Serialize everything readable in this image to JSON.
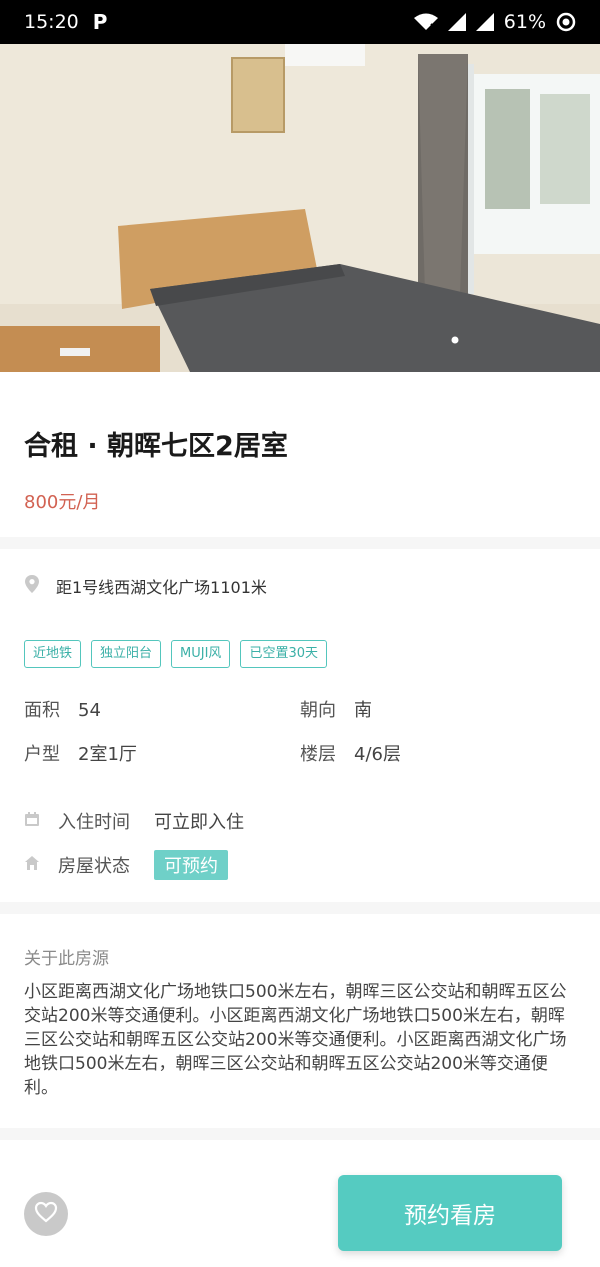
{
  "status_bar": {
    "time": "15:20",
    "app_icon": "P",
    "battery": "61%"
  },
  "listing": {
    "title": "合租 · 朝晖七区2居室",
    "price": "800元/月",
    "location": "距1号线西湖文化广场1101米",
    "tags": [
      "近地铁",
      "独立阳台",
      "MUJI风",
      "已空置30天"
    ],
    "specs": {
      "area_label": "面积",
      "area_value": "54",
      "orientation_label": "朝向",
      "orientation_value": "南",
      "layout_label": "户型",
      "layout_value": "2室1厅",
      "floor_label": "楼层",
      "floor_value": "4/6层"
    },
    "move_in_label": "入住时间",
    "move_in_value": "可立即入住",
    "status_label": "房屋状态",
    "status_value": "可预约"
  },
  "about": {
    "title": "关于此房源",
    "text": "小区距离西湖文化广场地铁口500米左右，朝晖三区公交站和朝晖五区公交站200米等交通便利。小区距离西湖文化广场地铁口500米左右，朝晖三区公交站和朝晖五区公交站200米等交通便利。小区距离西湖文化广场地铁口500米左右，朝晖三区公交站和朝晖五区公交站200米等交通便利。"
  },
  "actions": {
    "book_label": "预约看房"
  },
  "icons": {
    "location": "location-pin-icon",
    "calendar": "calendar-icon",
    "house": "house-icon",
    "favorite": "heart-icon"
  },
  "colors": {
    "accent": "#55cbc1",
    "price": "#d26252",
    "tag_border": "#54c6bd"
  }
}
